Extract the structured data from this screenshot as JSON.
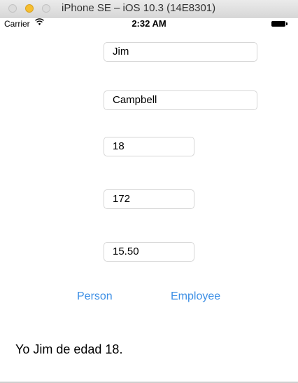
{
  "window": {
    "title": "iPhone SE – iOS 10.3 (14E8301)"
  },
  "statusbar": {
    "carrier": "Carrier",
    "time": "2:32 AM",
    "wifi_icon": "wifi-icon",
    "battery_icon": "battery-icon"
  },
  "form": {
    "first_name": "Jim",
    "last_name": "Campbell",
    "age": "18",
    "height": "172",
    "salary": "15.50"
  },
  "buttons": {
    "person": "Person",
    "employee": "Employee"
  },
  "result": {
    "text": "Yo Jim de edad 18."
  },
  "colors": {
    "accent": "#3d8fe5",
    "field_border": "#d6d6d6"
  }
}
